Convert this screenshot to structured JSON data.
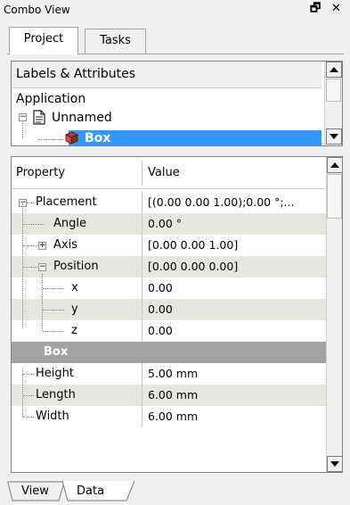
{
  "window": {
    "title": "Combo View",
    "float_glyph": "🗗",
    "close_glyph": "✕"
  },
  "tabs": [
    {
      "label": "Project",
      "active": true
    },
    {
      "label": "Tasks",
      "active": false
    }
  ],
  "tree": {
    "header": "Labels & Attributes",
    "root": "Application",
    "document": "Unnamed",
    "selected_object": "Box",
    "selection_color": "#3399ff"
  },
  "properties": {
    "header_property": "Property",
    "header_value": "Value",
    "rows": [
      {
        "name": "Placement",
        "value": "[(0.00 0.00 1.00);0.00 °;..."
      },
      {
        "name": "Angle",
        "value": "0.00 °"
      },
      {
        "name": "Axis",
        "value": "[0.00 0.00 1.00]"
      },
      {
        "name": "Position",
        "value": "[0.00 0.00 0.00]"
      },
      {
        "name": "x",
        "value": "0.00"
      },
      {
        "name": "y",
        "value": "0.00"
      },
      {
        "name": "z",
        "value": "0.00"
      },
      {
        "name": "Box",
        "value": ""
      },
      {
        "name": "Height",
        "value": "5.00 mm"
      },
      {
        "name": "Length",
        "value": "6.00 mm"
      },
      {
        "name": "Width",
        "value": "6.00 mm"
      }
    ]
  },
  "bottom_tabs": [
    {
      "label": "View",
      "active": false
    },
    {
      "label": "Data",
      "active": true
    }
  ]
}
